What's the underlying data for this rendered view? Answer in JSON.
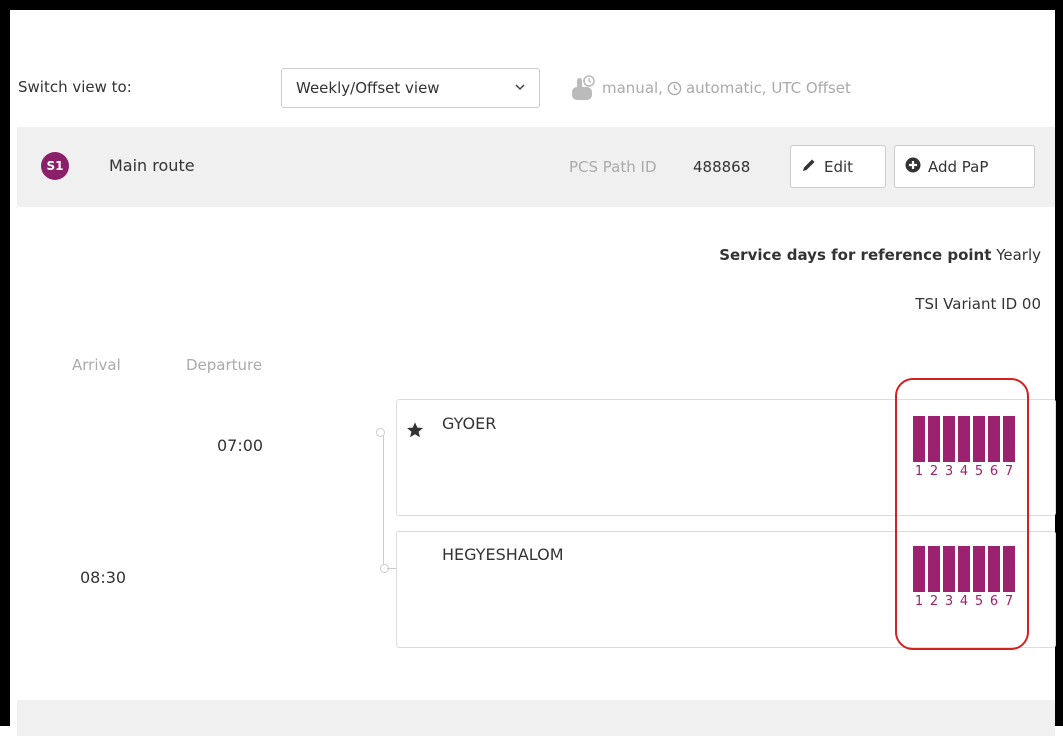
{
  "header": {
    "switch_label": "Switch view to:",
    "view_select": "Weekly/Offset view",
    "legend_manual": "manual,",
    "legend_rest": "automatic, UTC Offset"
  },
  "route": {
    "badge": "S1",
    "name": "Main route",
    "pcs_label": "PCS Path ID",
    "pcs_value": "488868",
    "edit_label": "Edit",
    "add_label": "Add PaP"
  },
  "info": {
    "service_days_label": "Service days for reference point",
    "service_days_value": "Yearly",
    "tsi_label": "TSI Variant ID",
    "tsi_value": "00"
  },
  "columns": {
    "arrival": "Arrival",
    "departure": "Departure"
  },
  "stops": [
    {
      "name": "GYOER",
      "arrival": "",
      "departure": "07:00",
      "reference": true,
      "days": [
        "1",
        "2",
        "3",
        "4",
        "5",
        "6",
        "7"
      ]
    },
    {
      "name": "HEGYESHALOM",
      "arrival": "08:30",
      "departure": "",
      "reference": false,
      "days": [
        "1",
        "2",
        "3",
        "4",
        "5",
        "6",
        "7"
      ]
    }
  ],
  "colors": {
    "accent": "#9c2270",
    "badge": "#8b1f6a",
    "highlight": "#d32020"
  },
  "icons": {
    "manual": "hand-pointer-icon",
    "automatic": "clock-icon",
    "edit": "pencil-icon",
    "add": "plus-circle-icon",
    "reference": "star-icon",
    "select": "chevron-down-icon"
  }
}
